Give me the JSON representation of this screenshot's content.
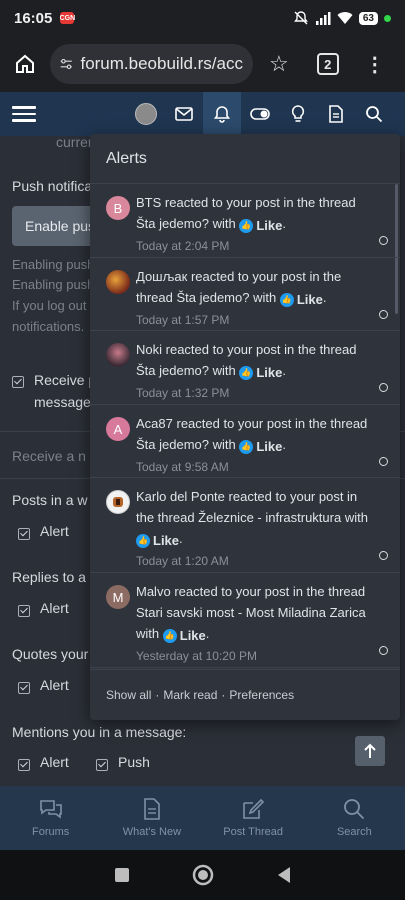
{
  "status_bar": {
    "time": "16:05",
    "app_badge": "CGN",
    "battery": "63"
  },
  "browser": {
    "url": "forum.beobuild.rs/acc",
    "tab_count": "2"
  },
  "background": {
    "current_text": "curren",
    "push_heading": "Push notifica",
    "enable_push_button": "Enable pus",
    "enabling_line1": "Enabling push",
    "enabling_line2": "Enabling push",
    "logout_line": "If you log out",
    "notifications_line": "notifications.",
    "receive_label_line1": "Receive p",
    "receive_label_line2": "message",
    "receive_section": "Receive a n",
    "posts_in": "Posts in a w",
    "replies_to": "Replies to a",
    "quotes_your": "Quotes your",
    "mentions": "Mentions you in a message:",
    "alert_label": "Alert",
    "push_label": "Push"
  },
  "alerts": {
    "title": "Alerts",
    "items": [
      {
        "avatar_letter": "B",
        "avatar_color": "#d9889b",
        "user": "BTS",
        "text": "reacted to your post in the thread Šta jedemo? with",
        "reaction": "Like",
        "time": "Today at 2:04 PM"
      },
      {
        "avatar_letter": "",
        "avatar_color": "#7a2a1a",
        "user": "Дошљак",
        "text": "reacted to your post in the thread Šta jedemo? with",
        "reaction": "Like",
        "time": "Today at 1:57 PM"
      },
      {
        "avatar_letter": "",
        "avatar_color": "#6b4a5a",
        "user": "Noki",
        "text": "reacted to your post in the thread Šta jedemo? with",
        "reaction": "Like",
        "time": "Today at 1:32 PM"
      },
      {
        "avatar_letter": "A",
        "avatar_color": "#d7799a",
        "user": "Aca87",
        "text": "reacted to your post in the thread Šta jedemo? with",
        "reaction": "Like",
        "time": "Today at 9:58 AM"
      },
      {
        "avatar_letter": "",
        "avatar_color": "#f2f2f2",
        "user": "Karlo del Ponte",
        "text": "reacted to your post in the thread Železnice - infrastruktura with",
        "reaction": "Like",
        "time": "Today at 1:20 AM"
      },
      {
        "avatar_letter": "M",
        "avatar_color": "#8c6b63",
        "user": "Malvo",
        "text": "reacted to your post in the thread Stari savski most - Most Miladina Zarica with",
        "reaction": "Like",
        "time": "Yesterday at 10:20 PM"
      }
    ],
    "footer": {
      "show_all": "Show all",
      "mark_read": "Mark read",
      "preferences": "Preferences",
      "separator": "·"
    }
  },
  "bottom_nav": [
    {
      "label": "Forums"
    },
    {
      "label": "What's New"
    },
    {
      "label": "Post Thread"
    },
    {
      "label": "Search"
    }
  ]
}
